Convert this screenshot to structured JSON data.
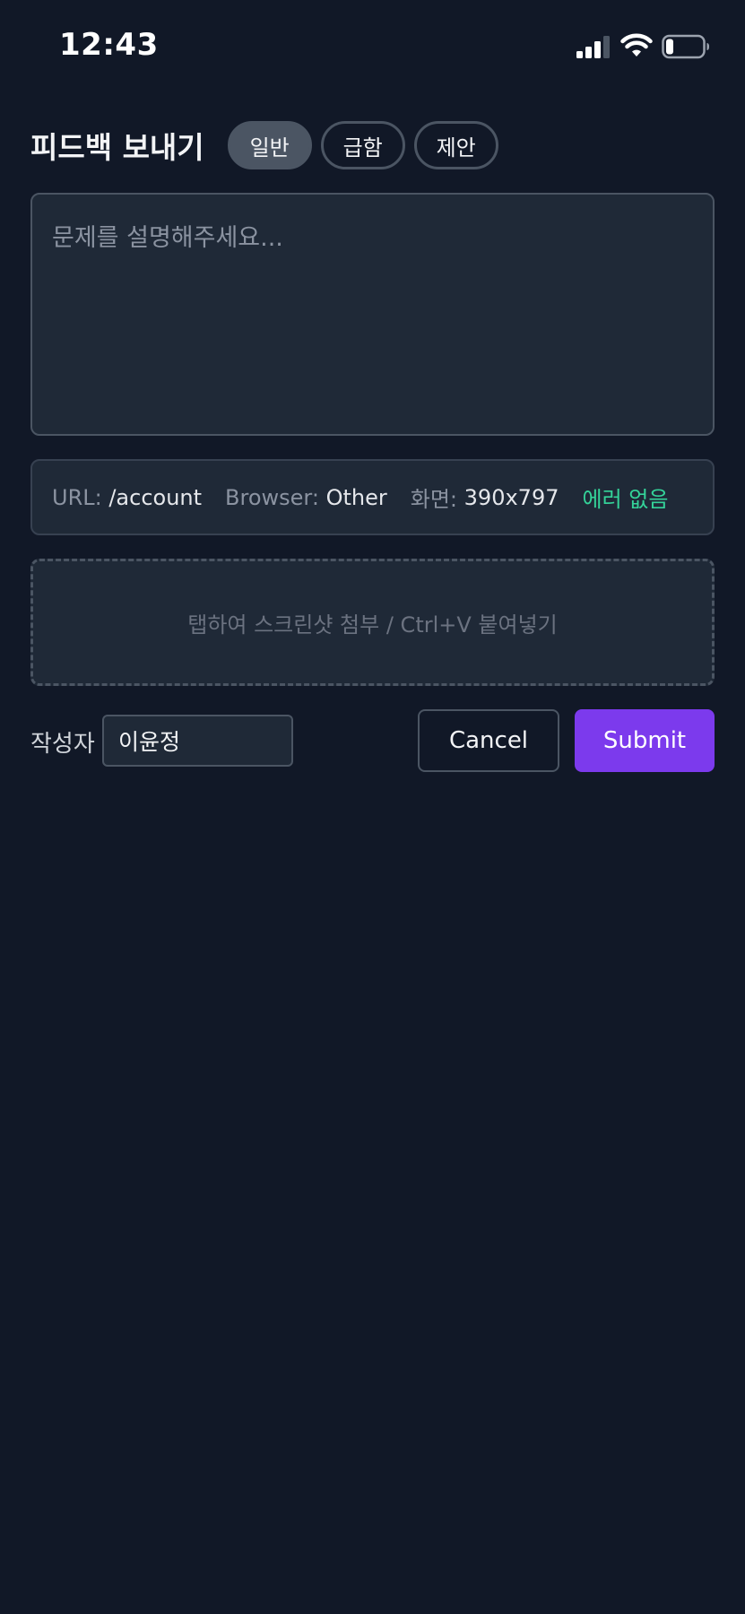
{
  "status_bar": {
    "time": "12:43",
    "icons": [
      "signal-icon",
      "wifi-icon",
      "battery-icon"
    ],
    "battery_level": 0.2
  },
  "header": {
    "title": "피드백 보내기",
    "tabs": [
      {
        "label": "일반",
        "active": true
      },
      {
        "label": "급함",
        "active": false
      },
      {
        "label": "제안",
        "active": false
      }
    ]
  },
  "form": {
    "description_placeholder": "문제를 설명해주세요...",
    "description_value": ""
  },
  "meta": {
    "url_label": "URL:",
    "url_value": "/account",
    "browser_label": "Browser:",
    "browser_value": "Other",
    "screen_label": "화면:",
    "screen_value": "390x797",
    "error_status": "에러 없음"
  },
  "attachment": {
    "hint": "탭하여 스크린샷 첨부 / Ctrl+V 붙여넣기"
  },
  "footer": {
    "author_label": "작성자",
    "author_value": "이윤정",
    "cancel_label": "Cancel",
    "submit_label": "Submit"
  },
  "colors": {
    "background": "#111827",
    "panel": "#1f2937",
    "border": "#4b5563",
    "accent": "#7c3aed",
    "success": "#34d399"
  }
}
